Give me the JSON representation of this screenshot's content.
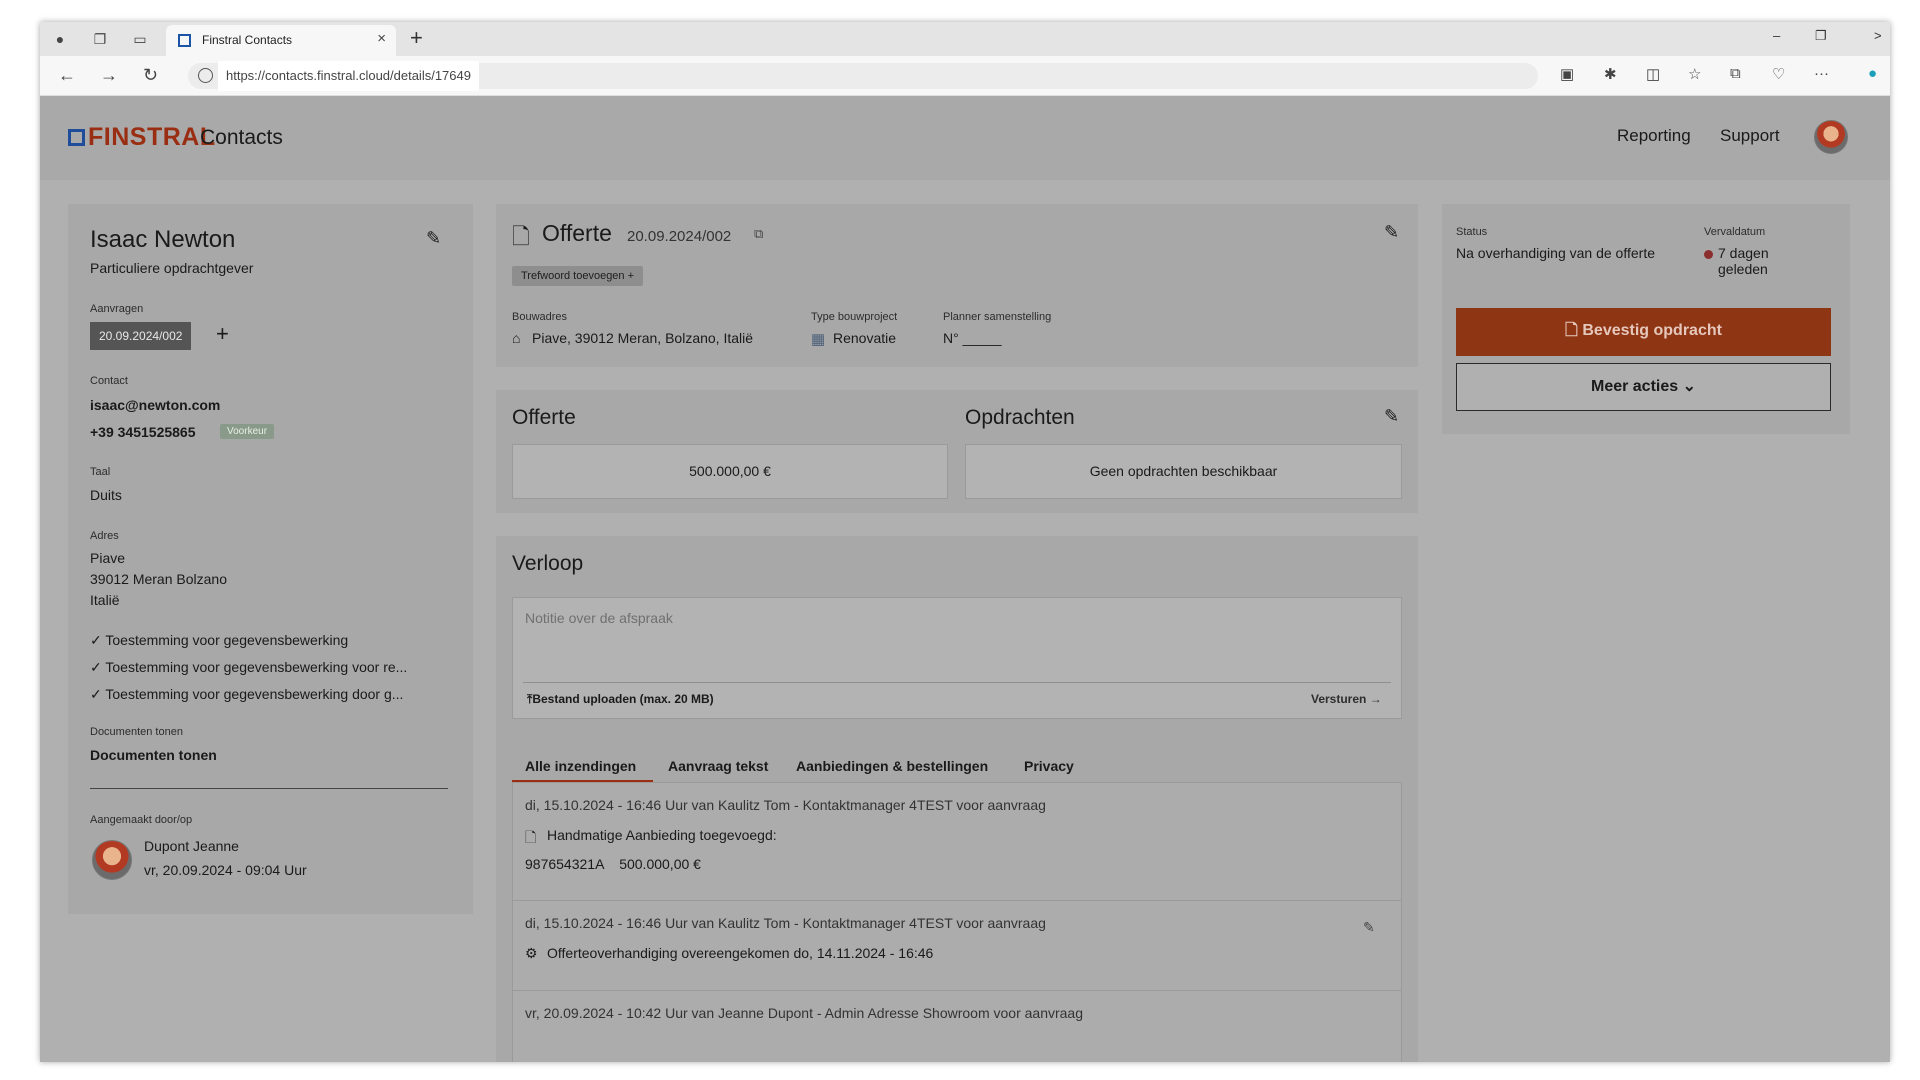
{
  "browser": {
    "tab_title": "Finstral Contacts",
    "url": "https://contacts.finstral.cloud/details/17649"
  },
  "header": {
    "logo": "FINSTRAL",
    "app_name": "Contacts",
    "links": [
      "Reporting",
      "Support"
    ]
  },
  "contact": {
    "name": "Isaac Newton",
    "type": "Particuliere opdrachtgever",
    "requests_label": "Aanvragen",
    "request_id": "20.09.2024/002",
    "contact_label": "Contact",
    "email": "isaac@newton.com",
    "phone": "+39 3451525865",
    "phone_badge": "Voorkeur",
    "language_label": "Taal",
    "language": "Duits",
    "address_label": "Adres",
    "address_line1": "Piave",
    "address_line2": "39012 Meran Bolzano",
    "address_line3": "Italië",
    "consents": [
      "Toestemming voor gegevensbewerking",
      "Toestemming voor gegevensbewerking voor re...",
      "Toestemming voor gegevensbewerking door g..."
    ],
    "docs_label": "Documenten tonen",
    "docs_link": "Documenten tonen",
    "created_label": "Aangemaakt door/op",
    "created_by": "Dupont Jeanne",
    "created_at": "vr, 20.09.2024 - 09:04 Uur"
  },
  "offer": {
    "title": "Offerte",
    "id": "20.09.2024/002",
    "tag_button": "Trefwoord toevoegen",
    "site_label": "Bouwadres",
    "site": "Piave, 39012 Meran, Bolzano, Italië",
    "project_label": "Type bouwproject",
    "project": "Renovatie",
    "planner_label": "Planner samenstelling",
    "planner": "N° _____"
  },
  "summary": {
    "offer_title": "Offerte",
    "offer_value": "500.000,00 €",
    "orders_title": "Opdrachten",
    "orders_value": "Geen opdrachten beschikbaar"
  },
  "history": {
    "title": "Verloop",
    "note_placeholder": "Notitie over de afspraak",
    "upload_label": "Bestand uploaden (max. 20 MB)",
    "send_label": "Versturen",
    "tabs": [
      "Alle inzendingen",
      "Aanvraag tekst",
      "Aanbiedingen & bestellingen",
      "Privacy"
    ],
    "entries": [
      {
        "header": "di, 15.10.2024 - 16:46 Uur van Kaulitz Tom - Kontaktmanager 4TEST voor aanvraag",
        "line1": "Handmatige Aanbieding toegevoegd:",
        "line2": "987654321A    500.000,00 €"
      },
      {
        "header": "di, 15.10.2024 - 16:46 Uur van Kaulitz Tom - Kontaktmanager 4TEST voor aanvraag",
        "line1": "Offerteoverhandiging overeengekomen do, 14.11.2024 - 16:46"
      },
      {
        "header": "vr, 20.09.2024 - 10:42 Uur van Jeanne Dupont - Admin Adresse Showroom voor aanvraag"
      }
    ]
  },
  "status": {
    "status_label": "Status",
    "status_value": "Na overhandiging van de offerte",
    "due_label": "Vervaldatum",
    "due_value_line1": "7 dagen",
    "due_value_line2": "geleden",
    "confirm_button": "Bevestig opdracht",
    "more_button": "Meer acties"
  }
}
